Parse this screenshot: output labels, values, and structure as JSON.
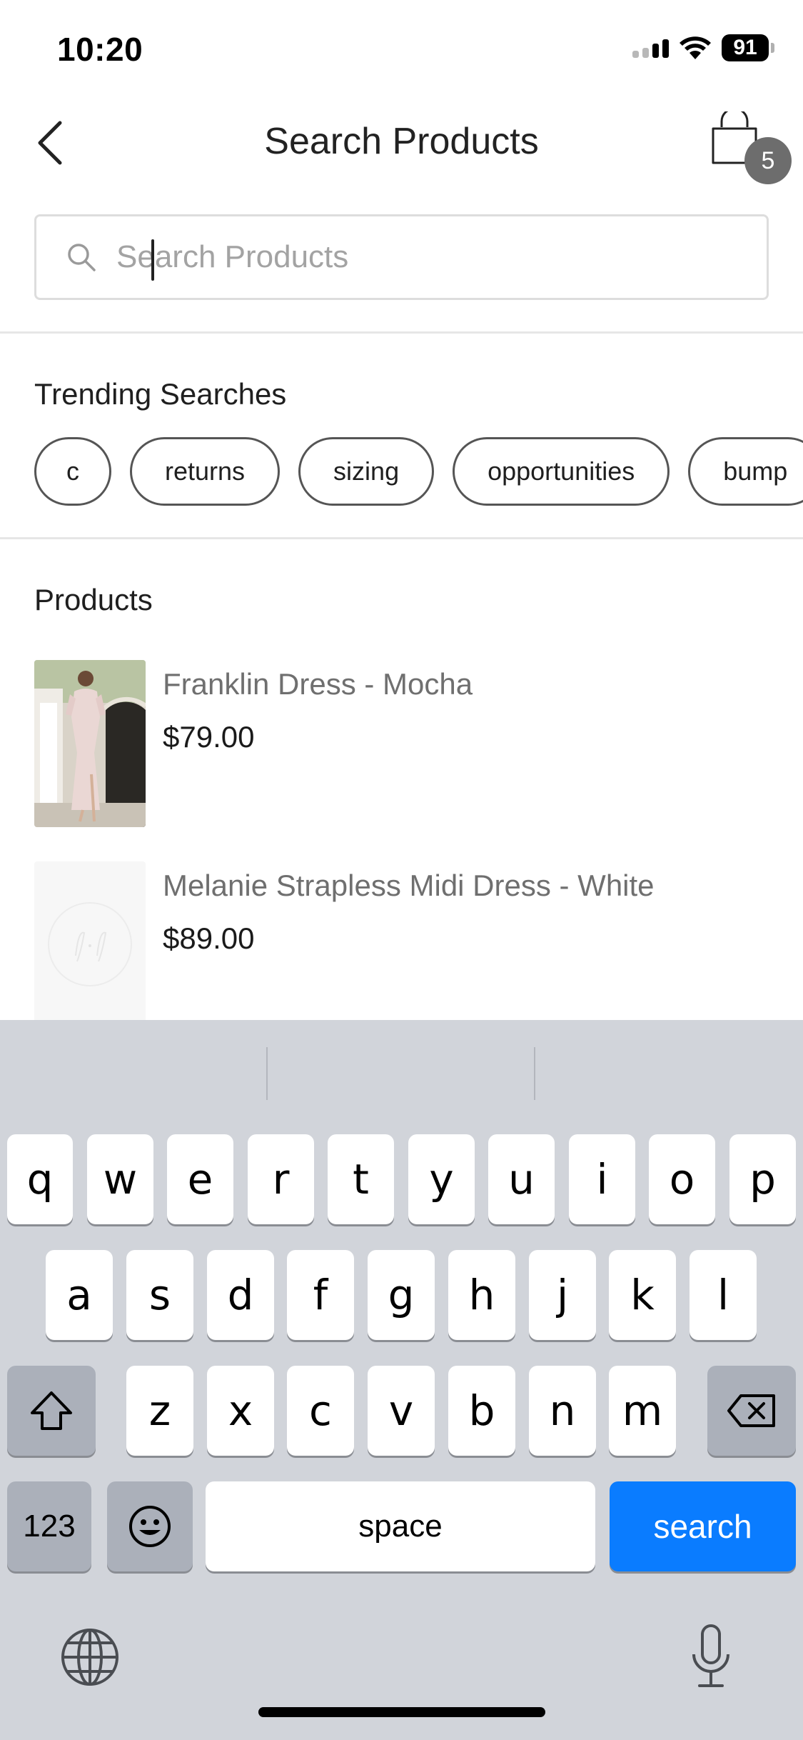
{
  "status_bar": {
    "time": "10:20",
    "battery": "91"
  },
  "header": {
    "title": "Search Products",
    "cart_count": "5"
  },
  "search": {
    "placeholder": "Search Products",
    "value": ""
  },
  "trending": {
    "title": "Trending Searches",
    "chips": [
      "c",
      "returns",
      "sizing",
      "opportunities",
      "bump"
    ]
  },
  "products": {
    "title": "Products",
    "items": [
      {
        "name": "Franklin Dress - Mocha",
        "price": "$79.00"
      },
      {
        "name": "Melanie Strapless Midi Dress - White",
        "price": "$89.00"
      }
    ]
  },
  "keyboard": {
    "row1": [
      "q",
      "w",
      "e",
      "r",
      "t",
      "y",
      "u",
      "i",
      "o",
      "p"
    ],
    "row2": [
      "a",
      "s",
      "d",
      "f",
      "g",
      "h",
      "j",
      "k",
      "l"
    ],
    "row3": [
      "z",
      "x",
      "c",
      "v",
      "b",
      "n",
      "m"
    ],
    "numbers_label": "123",
    "space_label": "space",
    "action_label": "search",
    "action_color": "#0a7cff"
  },
  "icons": {
    "back": "chevron-left-icon",
    "cart": "shopping-bag-icon",
    "search": "magnifier-icon",
    "shift": "shift-arrow-icon",
    "delete": "backspace-icon",
    "emoji": "emoji-icon",
    "globe": "globe-icon",
    "mic": "microphone-icon"
  }
}
